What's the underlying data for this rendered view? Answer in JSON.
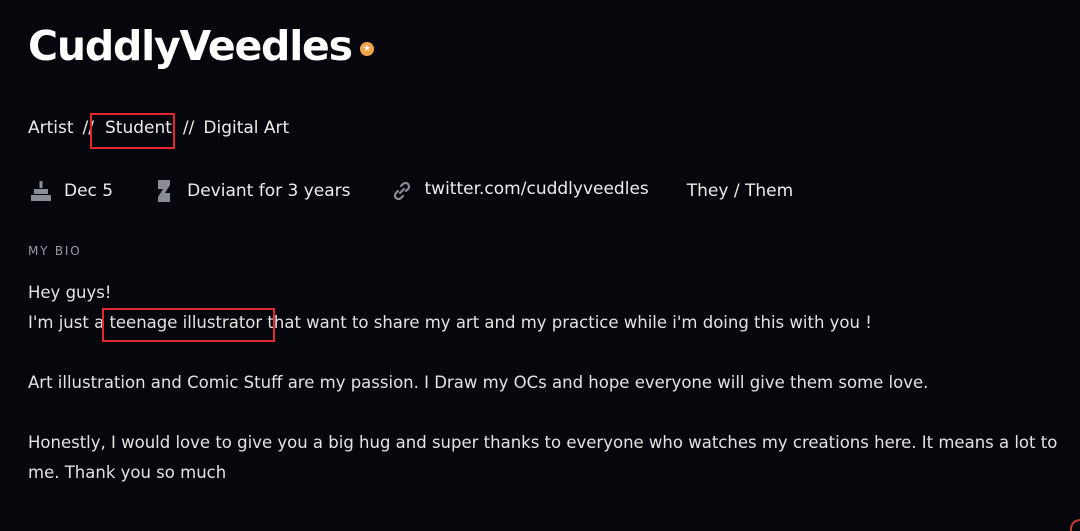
{
  "profile": {
    "username": "CuddlyVeedles",
    "badge_glyph": "★",
    "badge_color": "#f2a54a"
  },
  "tagline": {
    "items": [
      "Artist",
      "Student",
      "Digital Art"
    ],
    "separator": "//"
  },
  "meta": {
    "birthday": "Dec 5",
    "deviant_since": "Deviant for 3 years",
    "website": "twitter.com/cuddlyveedles",
    "pronouns": "They / Them"
  },
  "bio": {
    "heading": "MY BIO",
    "line1": "Hey guys!",
    "line2_before": "I'm just a ",
    "line2_highlight": "teenage illustrator",
    "line2_after": " that want to share my art and my practice while i'm doing this with you !",
    "paragraph2": "Art illustration and Comic Stuff are my passion. I Draw my OCs and hope everyone will give them some love.",
    "paragraph3": "Honestly, I would love to give you a big hug and super thanks to everyone who watches my creations here. It means a lot to me. Thank you so much"
  },
  "colors": {
    "background": "#06070d",
    "highlight_box": "#e3282d"
  }
}
